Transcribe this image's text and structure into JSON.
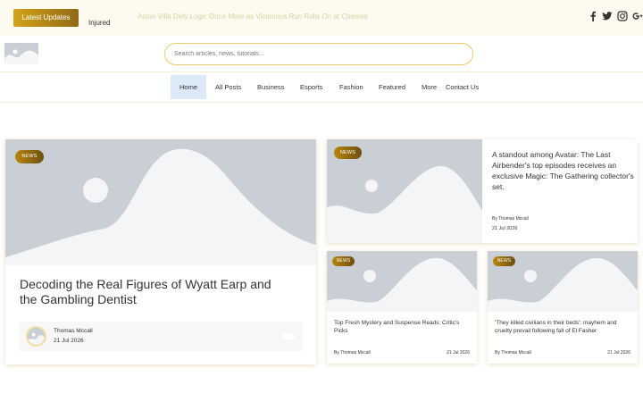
{
  "topbar": {
    "latest_label": "Latest Updates",
    "ticker_label": "Injured",
    "ticker_text": "Aston Villa Defy Logic Once More as Victorious Run Rolls On at Chelsea",
    "social": [
      {
        "name": "facebook-icon"
      },
      {
        "name": "twitter-icon"
      },
      {
        "name": "instagram-icon"
      },
      {
        "name": "google-plus-icon"
      }
    ]
  },
  "header": {
    "search_placeholder": "Search articles, news, tutorials..."
  },
  "nav": {
    "items": [
      "Home",
      "All Posts",
      "Business",
      "Esports",
      "Fashion",
      "Featured",
      "More",
      "Contact Us"
    ],
    "active": "Home"
  },
  "featured": {
    "tag": "NEWS",
    "title": "Decoding the Real Figures of Wyatt Earp and the Gambling Dentist",
    "author": "Thomas Mccall",
    "date": "21 Jul 2026"
  },
  "top_right": {
    "tag": "NEWS",
    "title": "A standout among Avatar: The Last Airbender's top episodes receives an exclusive Magic: The Gathering collector's set.",
    "by": "By Thomas Mccall",
    "date": "21 Jul 2026"
  },
  "small_cards": [
    {
      "tag": "NEWS",
      "title": "Top Fresh Mystery and Suspense Reads: Critic's Picks",
      "by": "By Thomas Mccall",
      "date": "21 Jul 2026"
    },
    {
      "tag": "NEWS",
      "title": "'They killed civilians in their beds': mayhem and cruelty prevail following fall of El Fasher",
      "by": "By Thomas Mccall",
      "date": "21 Jul 2026"
    }
  ],
  "colors": {
    "accent_gold": "#d4a418",
    "placeholder_grey": "#c9cfd4",
    "nav_active_bg": "#dce9f7"
  }
}
